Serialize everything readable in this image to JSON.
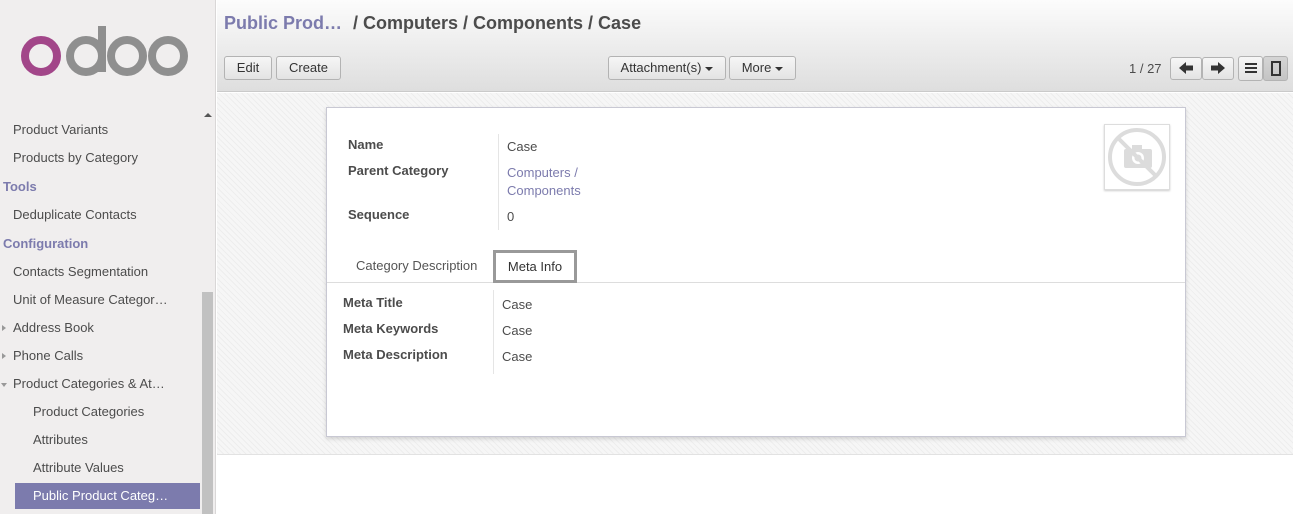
{
  "brand": {
    "logo_text": "odoo",
    "colors": {
      "accent": "#7c7bad",
      "logo_o": "#a24689",
      "logo_rest": "#8f8f8f"
    }
  },
  "sidebar": {
    "items": [
      {
        "label": "Product Variants",
        "kind": "item"
      },
      {
        "label": "Products by Category",
        "kind": "item"
      },
      {
        "label": "Tools",
        "kind": "header"
      },
      {
        "label": "Deduplicate Contacts",
        "kind": "item"
      },
      {
        "label": "Configuration",
        "kind": "header"
      },
      {
        "label": "Contacts Segmentation",
        "kind": "item"
      },
      {
        "label": "Unit of Measure Categor…",
        "kind": "item"
      },
      {
        "label": "Address Book",
        "kind": "folded"
      },
      {
        "label": "Phone Calls",
        "kind": "folded"
      },
      {
        "label": "Product Categories & At…",
        "kind": "open"
      },
      {
        "label": "Product Categories",
        "kind": "sub"
      },
      {
        "label": "Attributes",
        "kind": "sub"
      },
      {
        "label": "Attribute Values",
        "kind": "sub"
      },
      {
        "label": "Public Product Categ…",
        "kind": "active"
      }
    ]
  },
  "breadcrumb": {
    "parent": "Public Prod…",
    "current": "/ Computers / Components / Case"
  },
  "toolbar": {
    "edit_label": "Edit",
    "create_label": "Create",
    "attachments_label": "Attachment(s)",
    "more_label": "More"
  },
  "pager": {
    "value": "1 / 27"
  },
  "form": {
    "name_label": "Name",
    "name_value": "Case",
    "parent_label": "Parent Category",
    "parent_value_line1": "Computers /",
    "parent_value_line2": "Components",
    "sequence_label": "Sequence",
    "sequence_value": "0"
  },
  "tabs": [
    {
      "label": "Category Description",
      "active": false
    },
    {
      "label": "Meta Info",
      "active": true
    }
  ],
  "meta": {
    "title_label": "Meta Title",
    "title_value": "Case",
    "keywords_label": "Meta Keywords",
    "keywords_value": "Case",
    "description_label": "Meta Description",
    "description_value": "Case"
  },
  "icons": [
    "no-image-camera-icon",
    "arrow-left-icon",
    "arrow-right-icon",
    "list-view-icon",
    "form-view-icon",
    "scroll-up-icon"
  ]
}
